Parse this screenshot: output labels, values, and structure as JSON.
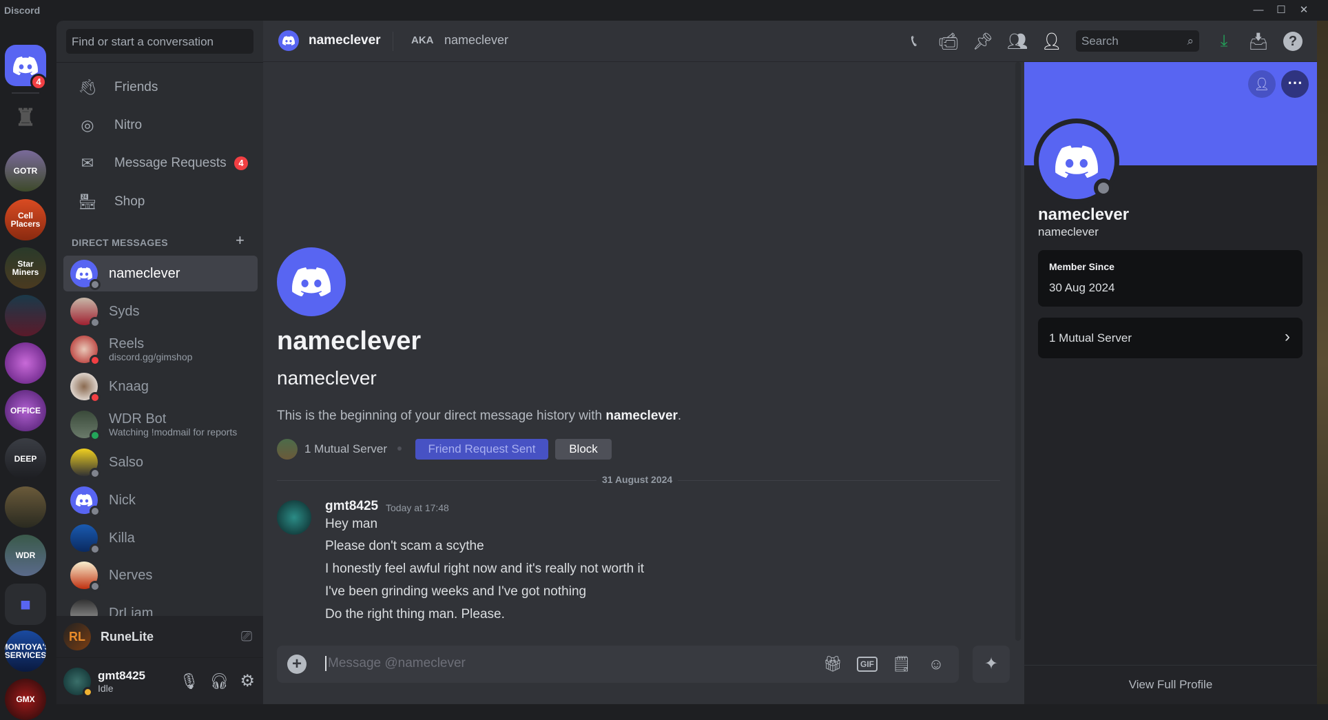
{
  "app": {
    "title": "Discord"
  },
  "colors": {
    "blurple": "#5865f2",
    "online": "#23a55a",
    "dnd": "#f23f43",
    "offline": "#80848e",
    "idle": "#f0b232",
    "download": "#23a55a"
  },
  "servers": [
    {
      "name": "Direct Messages",
      "badge": "4",
      "icon": "discord-logo"
    },
    {
      "name": "streaming-server",
      "icon": "screen-share-icon"
    },
    {
      "name": "GOTR"
    },
    {
      "name": "Cell Placers"
    },
    {
      "name": "Star Miners"
    },
    {
      "name": "server-6"
    },
    {
      "name": "server-7"
    },
    {
      "name": "OFFICE"
    },
    {
      "name": "DEEP"
    },
    {
      "name": "server-10"
    },
    {
      "name": "WDR"
    },
    {
      "name": "folder",
      "icon": "folder-icon"
    },
    {
      "name": "MONTOYA'S SERVICES"
    },
    {
      "name": "GMX"
    }
  ],
  "sidebar": {
    "search_placeholder": "Find or start a conversation",
    "nav": [
      {
        "label": "Friends",
        "icon": "friends-icon"
      },
      {
        "label": "Nitro",
        "icon": "nitro-icon"
      },
      {
        "label": "Message Requests",
        "icon": "envelope-icon",
        "badge": "4"
      },
      {
        "label": "Shop",
        "icon": "shop-icon"
      }
    ],
    "dm_header": "DIRECT MESSAGES",
    "dms": [
      {
        "name": "nameclever",
        "status": "offline",
        "selected": true
      },
      {
        "name": "Syds",
        "status": "offline"
      },
      {
        "name": "Reels",
        "status": "dnd",
        "sub": "discord.gg/gimshop"
      },
      {
        "name": "Knaag",
        "status": "dnd"
      },
      {
        "name": "WDR Bot",
        "status": "online",
        "sub": "Watching !modmail for reports"
      },
      {
        "name": "Salso",
        "status": "offline"
      },
      {
        "name": "Nick",
        "status": "offline"
      },
      {
        "name": "Killa",
        "status": "offline"
      },
      {
        "name": "Nerves",
        "status": "offline"
      },
      {
        "name": "DrLiam",
        "status": "offline"
      }
    ],
    "activity": {
      "name": "RuneLite"
    },
    "user": {
      "name": "gmt8425",
      "status": "Idle"
    }
  },
  "header": {
    "name": "nameclever",
    "aka_label": "AKA",
    "aka": "nameclever",
    "search_placeholder": "Search"
  },
  "intro": {
    "title": "nameclever",
    "username": "nameclever",
    "text": "This is the beginning of your direct message history with ",
    "text_bold": "nameclever",
    "text_end": ".",
    "mutual": "1 Mutual Server",
    "friend_btn": "Friend Request Sent",
    "block_btn": "Block"
  },
  "date_divider": "31 August 2024",
  "message": {
    "author": "gmt8425",
    "time": "Today at 17:48",
    "lines": [
      "Hey man",
      "Please don't scam a scythe",
      "I honestly feel awful right now and it's really not worth it",
      "I've been grinding weeks and I've got nothing",
      "Do the right thing man. Please."
    ]
  },
  "composer": {
    "placeholder": "Message @nameclever"
  },
  "profile": {
    "display_name": "nameclever",
    "username": "nameclever",
    "member_since_label": "Member Since",
    "member_since": "30 Aug 2024",
    "mutual": "1 Mutual Server",
    "view_full": "View Full Profile"
  }
}
